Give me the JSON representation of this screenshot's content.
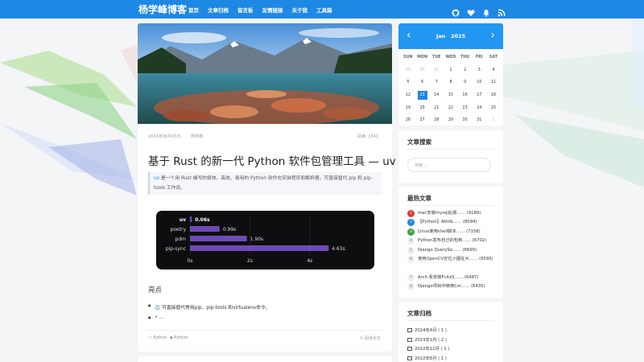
{
  "site": {
    "brand": "杨学峰博客"
  },
  "nav": {
    "items": [
      "首页",
      "文章归档",
      "留言板",
      "友情链接",
      "关于我",
      "工具箱"
    ]
  },
  "header_icons": [
    "github-icon",
    "heart-icon",
    "bell-icon",
    "rss-icon"
  ],
  "colors": {
    "accent": "#1e88e5",
    "calendar_header": "#2196f3",
    "bench_bar": "#6e4ab8"
  },
  "post": {
    "date": "2024年06月03日",
    "author": "杨学峰",
    "views": "阅读: 1541",
    "title": "基于 Rust 的新一代 Python 软件包管理工具 — uv",
    "summary_highlight": "uv",
    "summary": " 是一个用 Rust 编写的极快、高效、易用的 Python 软件包安装程序和解析器，可直接替代 pip 和 pip-tools 工作流。",
    "section_heading": "亮点",
    "bullets": [
      "⚖️ 可直接替代常用pip、pip-tools 和virtualenv命令。",
      "⚡ ..."
    ],
    "tags": [
      "Python",
      "Python"
    ],
    "readmore": "阅读全文"
  },
  "chart_data": {
    "type": "bar",
    "orientation": "horizontal",
    "categories": [
      "uv",
      "poetry",
      "pdm",
      "pip-sync"
    ],
    "values": [
      0.06,
      0.99,
      1.9,
      4.63
    ],
    "value_labels": [
      "0.06s",
      "0.99s",
      "1.90s",
      "4.63s"
    ],
    "xticks": [
      "0s",
      "2s",
      "4s"
    ],
    "xlim": [
      0,
      5
    ],
    "title": "",
    "xlabel": "",
    "ylabel": ""
  },
  "calendar": {
    "month": "Jan",
    "year": "2025",
    "weekdays": [
      "SUN",
      "MON",
      "TUE",
      "WED",
      "THU",
      "FRI",
      "SAT"
    ],
    "weeks": [
      [
        "29",
        "30",
        "31",
        "1",
        "2",
        "3",
        "4"
      ],
      [
        "5",
        "6",
        "7",
        "8",
        "9",
        "10",
        "11"
      ],
      [
        "12",
        "13",
        "14",
        "15",
        "16",
        "17",
        "18"
      ],
      [
        "19",
        "20",
        "21",
        "22",
        "23",
        "24",
        "25"
      ],
      [
        "26",
        "27",
        "28",
        "29",
        "30",
        "31",
        "1"
      ]
    ],
    "today": "13"
  },
  "search": {
    "title": "文章搜索",
    "placeholder": "搜索 ..."
  },
  "hot": {
    "title": "最热文章",
    "items": [
      {
        "rank": "1",
        "text": "mac安装mysql后报……",
        "count": "(9189)",
        "color": "#e53935"
      },
      {
        "rank": "2",
        "text": "【Python】Attrib……",
        "count": "(8094)",
        "color": "#1e88e5"
      },
      {
        "rank": "3",
        "text": "Linux使用shell脚本……",
        "count": "(7158)",
        "color": "#43a047"
      },
      {
        "rank": "4",
        "text": "Python发布自己的包到……",
        "count": "(6702)",
        "color": ""
      },
      {
        "rank": "5",
        "text": "Django QuerySe……",
        "count": "(6699)",
        "color": ""
      },
      {
        "rank": "6",
        "text": "使用OpenCV定位小图在大……",
        "count": "(6595)",
        "color": ""
      },
      {
        "rank": "7",
        "text": "Arch 系安装Fcitx5……",
        "count": "(6487)",
        "color": ""
      },
      {
        "rank": "8",
        "text": "Django项目中使用Cel……",
        "count": "(6435)",
        "color": ""
      }
    ]
  },
  "archive": {
    "title": "文章归档",
    "items": [
      "2024年4月 ( 1 )",
      "2023年1月 ( 2 )",
      "2022年12月 ( 1 )",
      "2022年6月 ( 1 )"
    ]
  }
}
